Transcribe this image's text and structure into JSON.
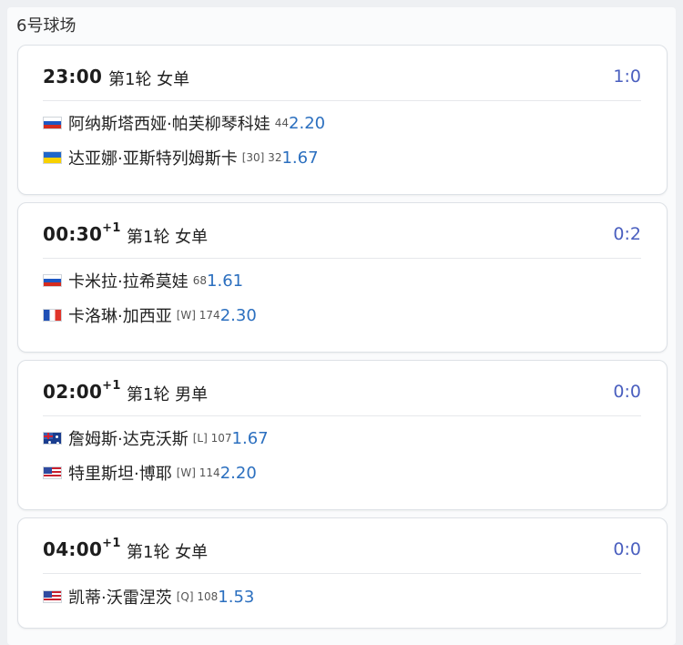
{
  "court": "6号球场",
  "matches": [
    {
      "time": "23:00",
      "plus": "",
      "round": "第1轮 女单",
      "score": "1:0",
      "players": [
        {
          "flag": "russia",
          "name": "阿纳斯塔西娅·帕芙柳琴科娃",
          "seed": "44",
          "odds": "2.20"
        },
        {
          "flag": "ukraine",
          "name": "达亚娜·亚斯特列姆斯卡",
          "seed": "[30] 32",
          "odds": "1.67"
        }
      ]
    },
    {
      "time": "00:30",
      "plus": "+1",
      "round": "第1轮 女单",
      "score": "0:2",
      "players": [
        {
          "flag": "russia",
          "name": "卡米拉·拉希莫娃",
          "seed": "68",
          "odds": "1.61"
        },
        {
          "flag": "france",
          "name": "卡洛琳·加西亚",
          "seed": "[W] 174",
          "odds": "2.30"
        }
      ]
    },
    {
      "time": "02:00",
      "plus": "+1",
      "round": "第1轮 男单",
      "score": "0:0",
      "players": [
        {
          "flag": "australia",
          "name": "詹姆斯·达克沃斯",
          "seed": "[L] 107",
          "odds": "1.67"
        },
        {
          "flag": "usa",
          "name": "特里斯坦·博耶",
          "seed": "[W] 114",
          "odds": "2.20"
        }
      ]
    },
    {
      "time": "04:00",
      "plus": "+1",
      "round": "第1轮 女单",
      "score": "0:0",
      "players": [
        {
          "flag": "usa",
          "name": "凯蒂·沃雷涅茨",
          "seed": "[Q] 108",
          "odds": "1.53"
        }
      ]
    }
  ]
}
